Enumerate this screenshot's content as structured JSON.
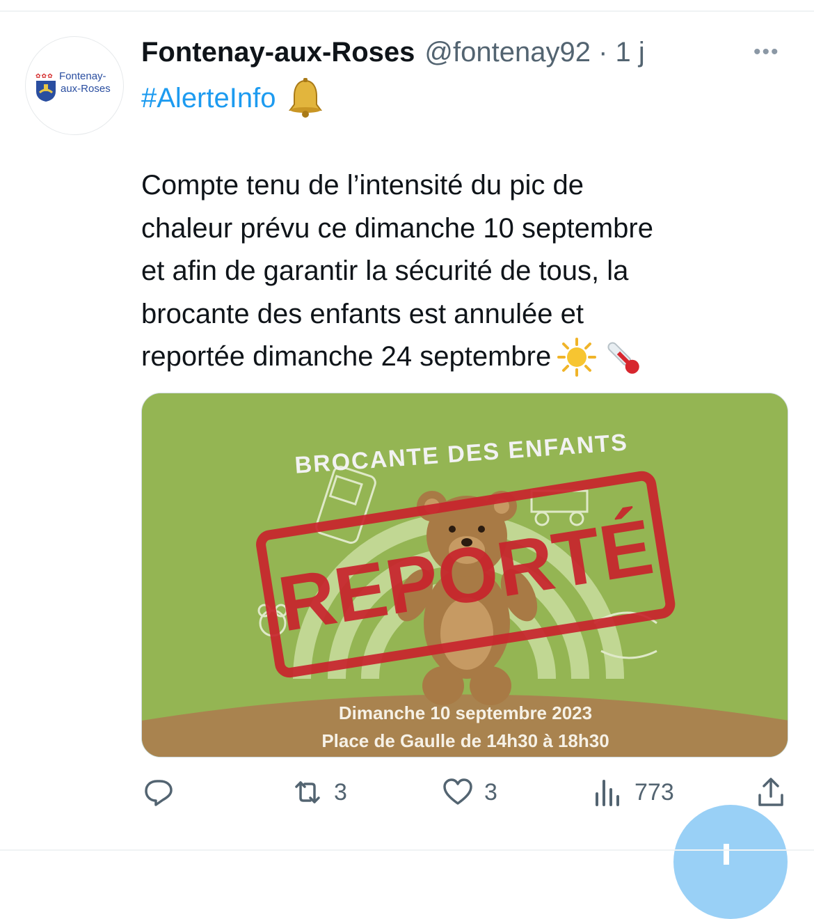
{
  "tweet": {
    "author_name": "Fontenay-aux-Roses",
    "handle_time": "@fontenay92 · 1 j",
    "more_label": "•••",
    "hashtag": "#AlerteInfo",
    "text_lines": [
      "Compte tenu de l’intensité du pic de",
      "chaleur prévu ce dimanche 10 septembre",
      "et afin de garantir la sécurité de tous, la",
      "brocante des enfants est annulée et",
      "reportée dimanche 24 septembre"
    ],
    "emoji_icons": [
      "bell-icon",
      "sun-icon",
      "thermometer-icon"
    ]
  },
  "avatar": {
    "line1": "Fontenay-",
    "line2": "aux-Roses",
    "flowers": "✿✿✿"
  },
  "image": {
    "title": "BROCANTE DES ENFANTS",
    "stamp": "REPORTÉ",
    "line1": "Dimanche 10 septembre 2023",
    "line2": "Place de Gaulle de 14h30 à 18h30",
    "colors": {
      "bg": "#94b553",
      "ground": "#a9834f",
      "stamp": "#c8242c"
    }
  },
  "actions": {
    "reply_count": "",
    "retweet_count": "3",
    "like_count": "3",
    "views_count": "773"
  },
  "colors": {
    "link": "#1d9bf0",
    "muted": "#536471",
    "fab": "#8ecbf5"
  }
}
